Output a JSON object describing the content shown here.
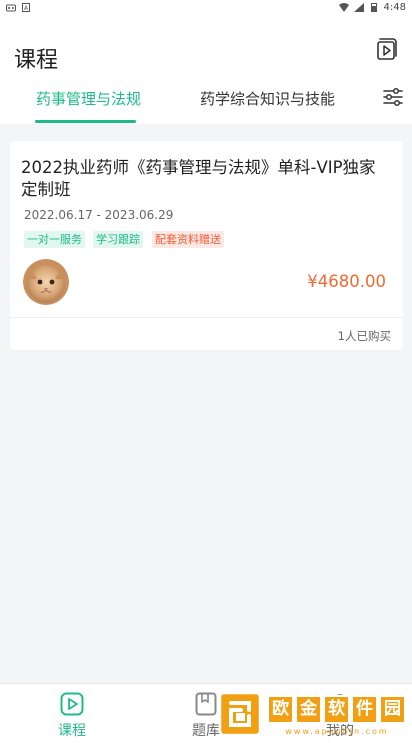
{
  "status_bar": {
    "time": "4:48"
  },
  "header": {
    "title": "课程",
    "tabs": [
      {
        "label": "药事管理与法规",
        "active": true
      },
      {
        "label": "药学综合知识与技能",
        "active": false
      }
    ]
  },
  "course": {
    "title": "2022执业药师《药事管理与法规》单科-VIP独家定制班",
    "date_range": "2022.06.17 - 2023.06.29",
    "tags": [
      "一对一服务",
      "学习跟踪",
      "配套资料赠送"
    ],
    "price": "¥4680.00",
    "buyers": "1人已购买"
  },
  "bottom_nav": {
    "items": [
      {
        "label": "课程",
        "icon": "play-icon",
        "active": true
      },
      {
        "label": "题库",
        "icon": "book-icon",
        "active": false
      },
      {
        "label": "我的",
        "icon": "user-icon",
        "active": false
      }
    ]
  },
  "watermark": {
    "chars": [
      "欧",
      "金",
      "软",
      "件",
      "园"
    ],
    "url": "www.apoubjn.com"
  },
  "colors": {
    "accent": "#1fb98a",
    "price": "#f06a31",
    "tag_red": "#ef5a34",
    "watermark": "#f2a013"
  }
}
